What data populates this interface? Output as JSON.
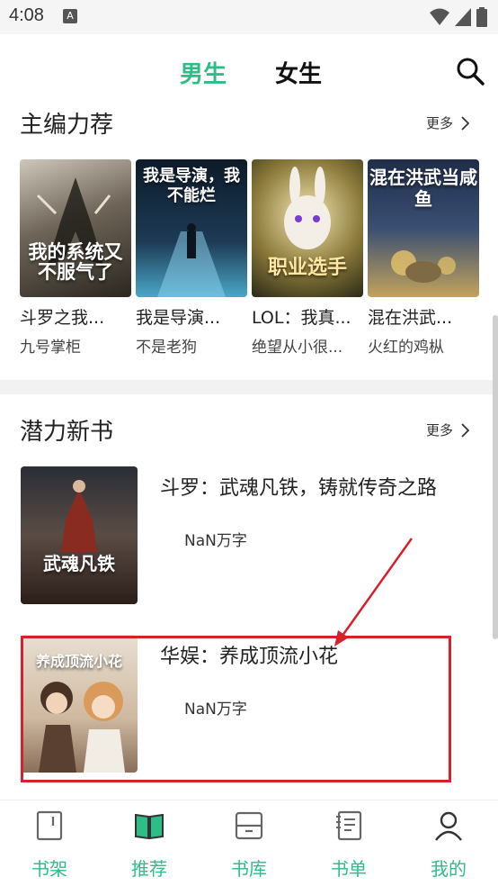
{
  "status_bar": {
    "time": "4:08",
    "notif_letter": "A"
  },
  "header": {
    "tabs": [
      {
        "label": "男生"
      },
      {
        "label": "女生"
      }
    ]
  },
  "sections": {
    "editor": {
      "title": "主编力荐",
      "more": "更多"
    },
    "new": {
      "title": "潜力新书",
      "more": "更多"
    }
  },
  "editor_books": [
    {
      "title": "斗罗之我...",
      "author": "九号掌柜",
      "cover_text": "我的系统又不服气了"
    },
    {
      "title": "我是导演...",
      "author": "不是老狗",
      "cover_text": "我是导演，我不能烂"
    },
    {
      "title": "LOL：我真...",
      "author": "绝望从小很...",
      "cover_text": "职业选手"
    },
    {
      "title": "混在洪武...",
      "author": "火红的鸡枞",
      "cover_text": "混在洪武当咸鱼"
    }
  ],
  "new_books": [
    {
      "title": "斗罗：武魂凡铁，铸就传奇之路",
      "words": "NaN万字",
      "cover_text": "武魂凡铁"
    },
    {
      "title": "华娱：养成顶流小花",
      "words": "NaN万字",
      "cover_text": "养成顶流小花"
    }
  ],
  "bottom_nav": [
    {
      "label": "书架",
      "icon": "bookshelf-icon"
    },
    {
      "label": "推荐",
      "icon": "recommend-book-icon"
    },
    {
      "label": "书库",
      "icon": "library-icon"
    },
    {
      "label": "书单",
      "icon": "booklist-icon"
    },
    {
      "label": "我的",
      "icon": "profile-icon"
    }
  ],
  "colors": {
    "accent": "#2dbd87",
    "highlight": "#d8202c"
  }
}
